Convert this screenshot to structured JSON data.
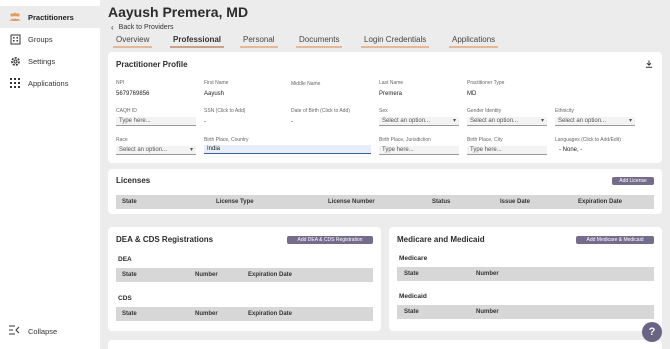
{
  "sidebar": {
    "items": [
      {
        "label": "Practitioners",
        "icon": "people-icon"
      },
      {
        "label": "Groups",
        "icon": "building-icon"
      },
      {
        "label": "Settings",
        "icon": "gear-icon"
      },
      {
        "label": "Applications",
        "icon": "grid-icon"
      }
    ],
    "collapse_label": "Collapse"
  },
  "header": {
    "title": "Aayush Premera, MD",
    "back_label": "Back to Providers"
  },
  "tabs": [
    "Overview",
    "Professional",
    "Personal",
    "Documents",
    "Login Credentials",
    "Applications"
  ],
  "profile": {
    "title": "Practitioner Profile",
    "npi": {
      "label": "NPI",
      "value": "5679769856"
    },
    "first_name": {
      "label": "First Name",
      "value": "Aayush"
    },
    "middle_name": {
      "label": "Middle Name",
      "value": ""
    },
    "last_name": {
      "label": "Last Name",
      "value": "Premera"
    },
    "practitioner_type": {
      "label": "Practitioner Type",
      "value": "MD"
    },
    "caqh_id": {
      "label": "CAQH ID",
      "placeholder": "Type here..."
    },
    "ssn": {
      "label": "SSN (Click to Add)",
      "value": "-"
    },
    "dob": {
      "label": "Date of Birth (Click to Add)",
      "value": "-"
    },
    "sex": {
      "label": "Sex",
      "placeholder": "Select an option..."
    },
    "gender_identity": {
      "label": "Gender Identity",
      "placeholder": "Select an option..."
    },
    "ethnicity": {
      "label": "Ethnicity",
      "placeholder": "Select an option..."
    },
    "race": {
      "label": "Race",
      "placeholder": "Select an option..."
    },
    "birth_country": {
      "label": "Birth Place, Country",
      "value": "India"
    },
    "birth_jurisdiction": {
      "label": "Birth Place, Jurisdiction",
      "placeholder": "Type here..."
    },
    "birth_city": {
      "label": "Birth Place, City",
      "placeholder": "Type here..."
    },
    "languages": {
      "label": "Languages (Click to Add/Edit)",
      "value": "- None, -"
    }
  },
  "licenses": {
    "title": "Licenses",
    "add_label": "Add License",
    "columns": [
      "State",
      "License Type",
      "License Number",
      "Status",
      "Issue Date",
      "Expiration Date"
    ]
  },
  "dea_cds": {
    "title": "DEA & CDS Registrations",
    "add_label": "Add DEA & CDS Registration",
    "dea_label": "DEA",
    "cds_label": "CDS",
    "columns": [
      "State",
      "Number",
      "Expiration Date"
    ]
  },
  "medicare": {
    "title": "Medicare and Medicaid",
    "add_label": "Add Medicare & Medicaid",
    "medicare_label": "Medicare",
    "medicaid_label": "Medicaid",
    "columns": [
      "State",
      "Number"
    ]
  },
  "help_label": "?"
}
